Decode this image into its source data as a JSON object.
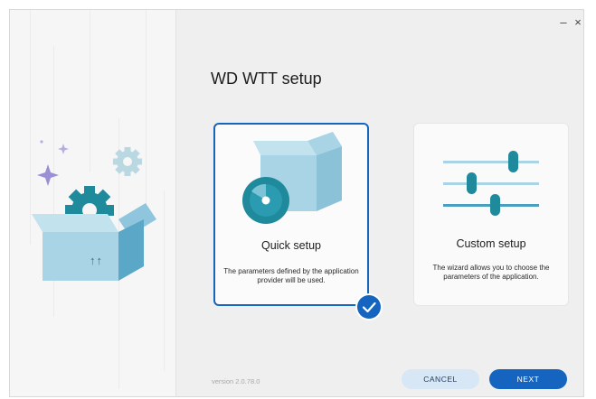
{
  "window": {
    "minimize_glyph": "–",
    "close_glyph": "×"
  },
  "title": "WD WTT setup",
  "options": [
    {
      "label": "Quick setup",
      "description": "The parameters defined by the application provider will be used.",
      "selected": true,
      "icon": "box-disc-icon"
    },
    {
      "label": "Custom setup",
      "description": "The wizard allows you to choose the parameters of the application.",
      "selected": false,
      "icon": "sliders-icon"
    }
  ],
  "version": "version 2.0.78.0",
  "buttons": {
    "cancel": "CANCEL",
    "next": "NEXT"
  },
  "illustration": {
    "icon": "box-gear-illustration",
    "box_marking": "↑↑"
  },
  "colors": {
    "accent": "#1565c0",
    "teal": "#1e8a9c",
    "light_blue": "#a8d4e6",
    "cancel_bg": "#d7e7f5"
  }
}
